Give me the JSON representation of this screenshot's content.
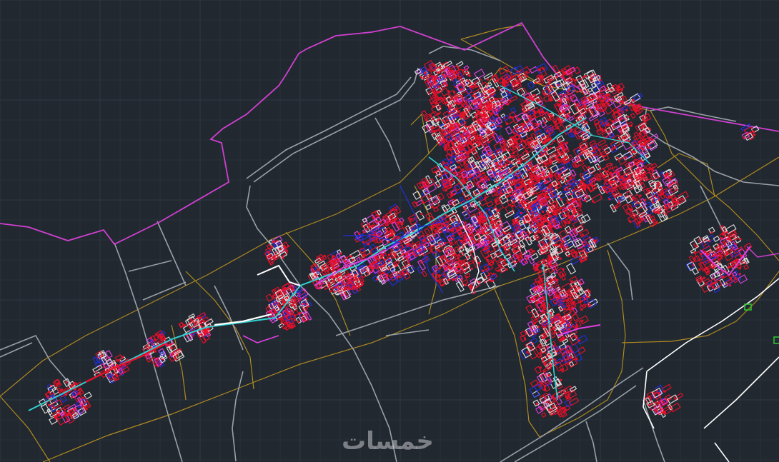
{
  "watermark": {
    "text": "خمسات"
  },
  "colors": {
    "background": "#212830",
    "grid": "#2f3843",
    "boundary": "#d040d0",
    "zones": "#b08a20",
    "roads": "#9aa0a8",
    "buildings": "#e0e0e0",
    "pipes_red": "#e8102a",
    "pipes_blue": "#2030e0",
    "pipes_cyan": "#30d0d0",
    "pipes_magenta": "#e040e0",
    "marker_green": "#30c030",
    "highway": "#ffffff"
  }
}
